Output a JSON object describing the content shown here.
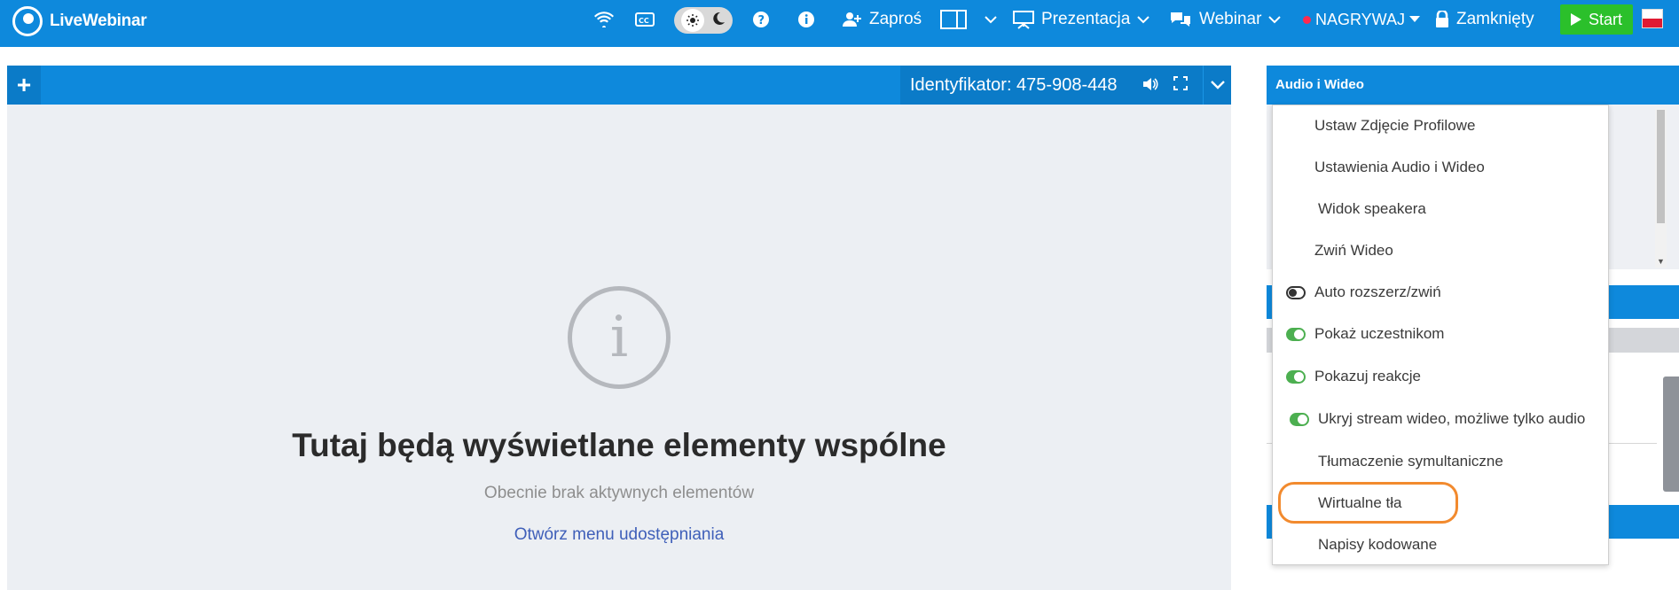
{
  "app": {
    "name": "LiveWebinar"
  },
  "topbar": {
    "invite": "Zaproś",
    "presentation": "Prezentacja",
    "webinar": "Webinar",
    "record": "NAGRYWAJ",
    "closed": "Zamknięty",
    "start": "Start",
    "flag_colors": [
      "#ffffff",
      "#e01a32"
    ]
  },
  "main": {
    "identifier": "Identyfikator: 475-908-448",
    "empty_title": "Tutaj będą wyświetlane elementy wspólne",
    "empty_subtitle": "Obecnie brak aktywnych elementów",
    "empty_link": "Otwórz menu udostępniania"
  },
  "right_panel": {
    "title": "Audio i Wideo"
  },
  "menu": {
    "items": [
      {
        "label": "Ustaw Zdjęcie Profilowe",
        "icon": "user-circle-icon"
      },
      {
        "label": "Ustawienia Audio i Wideo",
        "icon": "gear-icon"
      },
      {
        "label": "Widok speakera",
        "icon": "speaker-view-icon"
      },
      {
        "label": "Zwiń Wideo",
        "icon": "swap-arrows-icon"
      },
      {
        "label": "Auto rozszerz/zwiń",
        "icon": "toggle-off-icon"
      },
      {
        "label": "Pokaż uczestnikom",
        "icon": "toggle-on-icon"
      },
      {
        "label": "Pokazuj reakcje",
        "icon": "toggle-on-icon"
      },
      {
        "label": "Ukryj stream wideo, możliwe tylko audio",
        "icon": "toggle-on-icon"
      },
      {
        "label": "Tłumaczenie symultaniczne",
        "icon": "globe-icon"
      },
      {
        "label": "Wirtualne tła",
        "icon": "user-avatar-icon"
      },
      {
        "label": "Napisy kodowane",
        "icon": "closed-captions-icon"
      }
    ]
  },
  "colors": {
    "brand_blue": "#0e89dc",
    "start_green": "#2bc02b",
    "highlight_orange": "#f28a2e"
  }
}
